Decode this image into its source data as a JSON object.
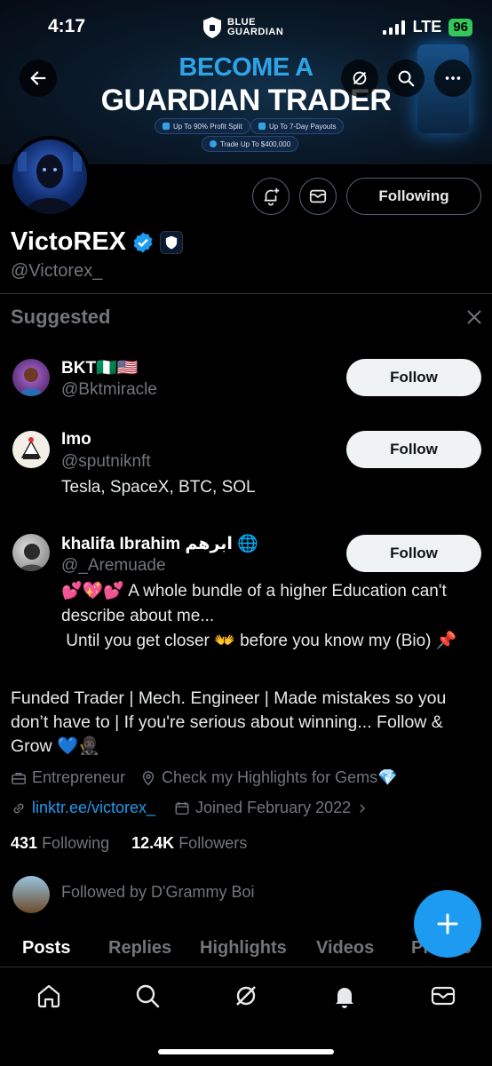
{
  "status_bar": {
    "time": "4:17",
    "network": "LTE",
    "battery": "96"
  },
  "banner": {
    "brand_line1": "BLUE",
    "brand_line2": "GUARDIAN",
    "headline1": "BECOME A",
    "headline2": "GUARDIAN TRADER",
    "pills": [
      "Up To 90% Profit Split",
      "Up To 7-Day Payouts",
      "Trade Up To $400,000"
    ]
  },
  "profile": {
    "name": "VictoREX",
    "handle": "@Victorex_",
    "following_button": "Following",
    "bio": "Funded Trader | Mech. Engineer | Made mistakes so you don’t have to | If you're serious about winning... Follow & Grow 💙🥷🏿",
    "category": "Entrepreneur",
    "location": "Check my Highlights for Gems💎",
    "link": "linktr.ee/victorex_",
    "joined": "Joined February 2022",
    "following_count": "431",
    "following_label": "Following",
    "followers_count": "12.4K",
    "followers_label": "Followers",
    "followed_by": "Followed by D'Grammy Boi"
  },
  "suggested": {
    "title": "Suggested",
    "follow_label": "Follow",
    "items": [
      {
        "name": "BKT🇳🇬🇺🇸",
        "handle": "@Bktmiracle",
        "bio": ""
      },
      {
        "name": "Imo",
        "handle": "@sputniknft",
        "bio": "Tesla, SpaceX, BTC, SOL"
      },
      {
        "name": "khalifa Ibrahim ابرهم 🌐",
        "handle": "@_Aremuade",
        "bio_line1": "💕💖💕 A whole bundle of a higher Education can't",
        "bio_line2": "describe about me...",
        "bio_line3": " Until you get closer 👐 before you know my (Bio) 📌"
      }
    ]
  },
  "tabs": [
    "Posts",
    "Replies",
    "Highlights",
    "Videos",
    "Photos"
  ],
  "colors": {
    "accent": "#1d9bf0",
    "background": "#000000",
    "muted": "#71767b"
  }
}
